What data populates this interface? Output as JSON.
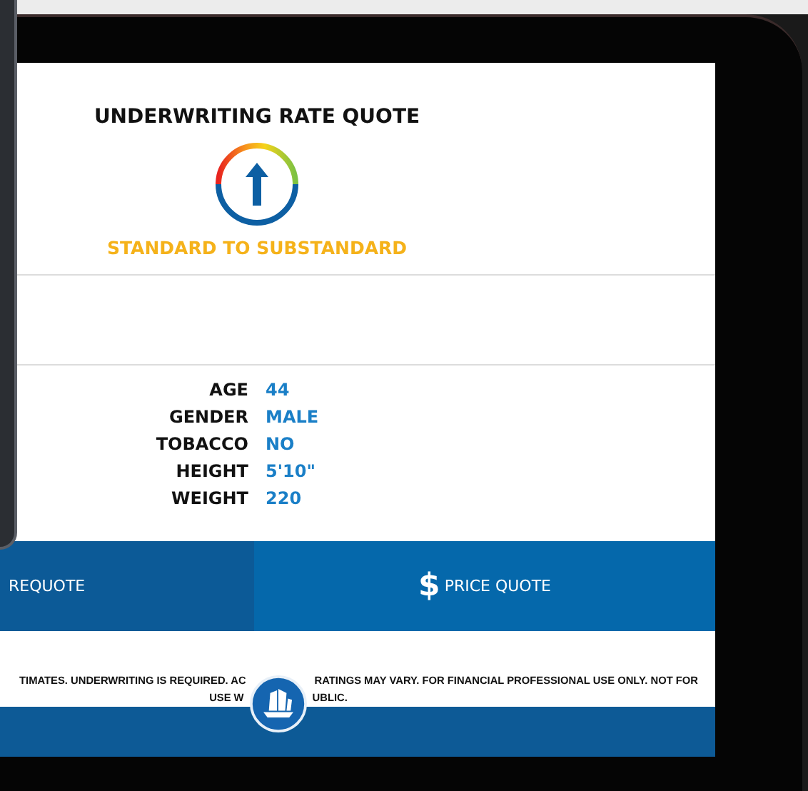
{
  "quote": {
    "title": "UNDERWRITING RATE QUOTE",
    "rating": "STANDARD TO SUBSTANDARD"
  },
  "details": [
    {
      "label": "AGE",
      "value": "44"
    },
    {
      "label": "GENDER",
      "value": "MALE"
    },
    {
      "label": "TOBACCO",
      "value": "NO"
    },
    {
      "label": "HEIGHT",
      "value": "5'10\""
    },
    {
      "label": "WEIGHT",
      "value": "220"
    }
  ],
  "actions": [
    {
      "kind": "requote",
      "label": "REQUOTE"
    },
    {
      "kind": "price",
      "label": "PRICE QUOTE",
      "icon": "$"
    }
  ],
  "disclaimer": [
    "TIMATES. UNDERWRITING IS REQUIRED. AC",
    "RATINGS MAY VARY. FOR FINANCIAL PROFESSIONAL USE ONLY. NOT FOR",
    "USE W",
    "UBLIC."
  ]
}
